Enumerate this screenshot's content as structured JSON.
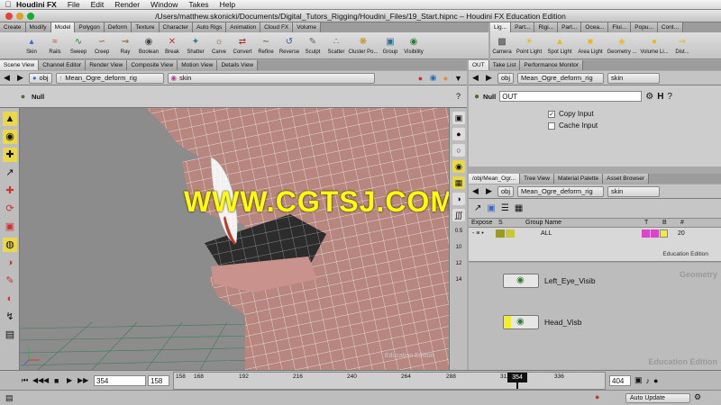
{
  "menubar": {
    "app": "Houdini FX",
    "items": [
      "File",
      "Edit",
      "Render",
      "Window",
      "Takes",
      "Help"
    ]
  },
  "window_title": "/Users/matthew.skonicki/Documents/Digital_Tutors_Rigging/Houdini_Files/19_Start.hipnc – Houdini FX Education Edition",
  "shelf_tabs": [
    "Create",
    "Modify",
    "Model",
    "Polygon",
    "Deform",
    "Texture",
    "Character",
    "Auto Rigs",
    "Animation",
    "Cloud FX",
    "Volume"
  ],
  "shelf_tools": [
    {
      "label": "Skin",
      "icon": "skin-icon"
    },
    {
      "label": "Rails",
      "icon": "rails-icon"
    },
    {
      "label": "Sweep",
      "icon": "sweep-icon"
    },
    {
      "label": "Creep",
      "icon": "creep-icon"
    },
    {
      "label": "Ray",
      "icon": "ray-icon"
    },
    {
      "label": "Boolean",
      "icon": "boolean-icon"
    },
    {
      "label": "Break",
      "icon": "break-icon"
    },
    {
      "label": "Shatter",
      "icon": "shatter-icon"
    },
    {
      "label": "Carve",
      "icon": "carve-icon"
    },
    {
      "label": "Convert",
      "icon": "convert-icon"
    },
    {
      "label": "Refine",
      "icon": "refine-icon"
    },
    {
      "label": "Reverse",
      "icon": "reverse-icon"
    },
    {
      "label": "Sculpt",
      "icon": "sculpt-icon"
    },
    {
      "label": "Scatter",
      "icon": "scatter-icon"
    },
    {
      "label": "Cluster Po...",
      "icon": "cluster-icon"
    },
    {
      "label": "Group",
      "icon": "group-icon"
    },
    {
      "label": "Visibility",
      "icon": "visibility-icon"
    }
  ],
  "light_tabs": [
    "Lig...",
    "Part...",
    "Rigi...",
    "Part...",
    "Ocea...",
    "Flui...",
    "Popu...",
    "Cont..."
  ],
  "light_tools": [
    {
      "label": "Camera"
    },
    {
      "label": "Point Light"
    },
    {
      "label": "Spot Light"
    },
    {
      "label": "Area Light"
    },
    {
      "label": "Geometry ..."
    },
    {
      "label": "Volume Li..."
    },
    {
      "label": "Dist..."
    }
  ],
  "left_pane": {
    "tabs": [
      "Scene View",
      "Channel Editor",
      "Render View",
      "Composite View",
      "Motion View",
      "Details View"
    ],
    "path": [
      "obj",
      "Mean_Ogre_deform_rig",
      "skin"
    ],
    "null_label": "Null"
  },
  "param_pane": {
    "tabs": [
      "OUT",
      "Take List",
      "Performance Monitor"
    ],
    "path": [
      "obj",
      "Mean_Ogre_deform_rig",
      "skin"
    ],
    "node_type": "Null",
    "node_name": "OUT",
    "copy_input": "Copy Input",
    "cache_input": "Cache Input",
    "copy_checked": true,
    "cache_checked": false
  },
  "network_pane": {
    "tabs": [
      "/obj/Mean_Ogr...",
      "Tree View",
      "Material Palette",
      "Asset Browser"
    ],
    "path": [
      "obj",
      "Mean_Ogre_deform_rig",
      "skin"
    ],
    "columns": {
      "expose": "Expose",
      "s": "S",
      "group_name": "Group Name",
      "t": "T",
      "b": "B",
      "num": "#"
    },
    "row": {
      "group": "ALL",
      "num": "20"
    },
    "edu_small": "Education Edition",
    "geometry": "Geometry",
    "edu_large": "Education Edition",
    "nodes": [
      "Left_Eye_Visib",
      "Head_Visb"
    ]
  },
  "viewport": {
    "watermark": "WWW.CGTSJ.COM",
    "edu": "Education Edition",
    "ruler": [
      "0.5",
      "10",
      "12",
      "14"
    ]
  },
  "timeline": {
    "start": "354",
    "end": "158",
    "ticks": [
      "158",
      "168",
      "192",
      "216",
      "240",
      "264",
      "288",
      "312",
      "336",
      "354"
    ],
    "current": "354",
    "range_end": "404"
  },
  "status": {
    "auto_update": "Auto Update"
  }
}
